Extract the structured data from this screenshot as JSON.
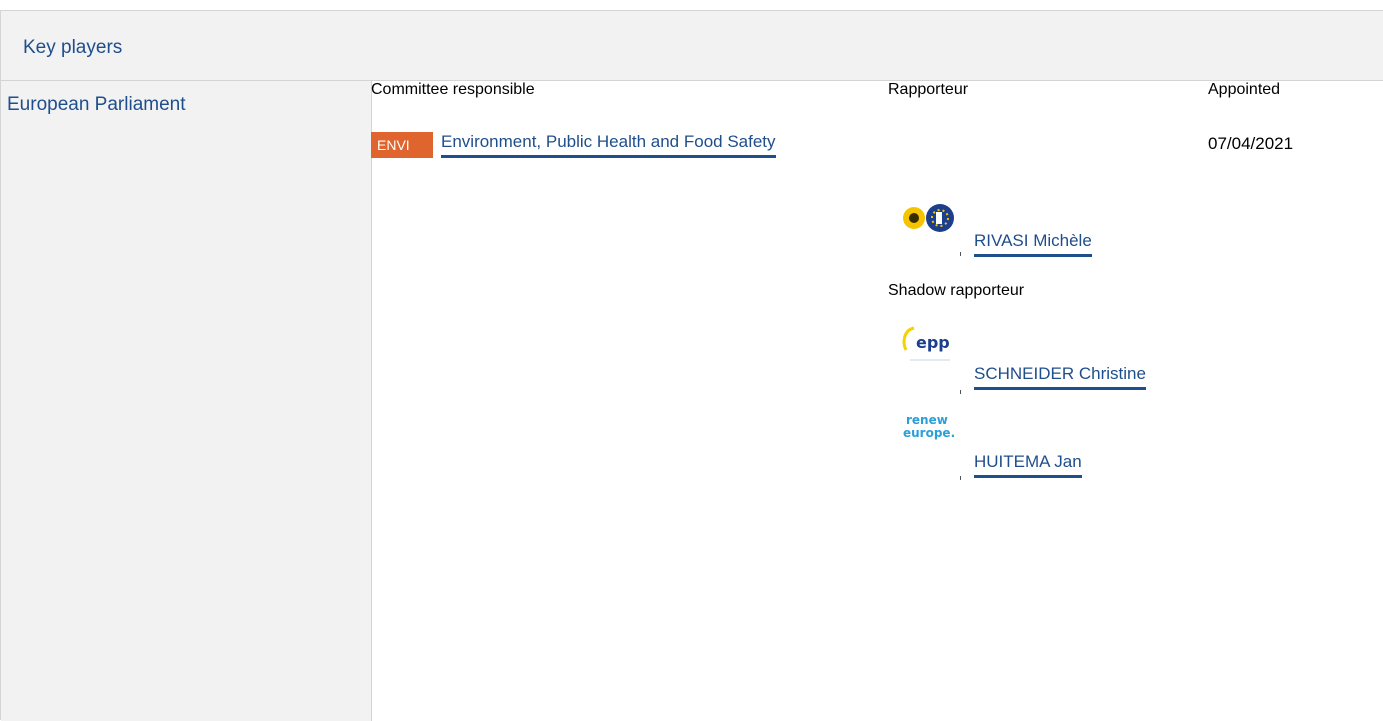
{
  "panel": {
    "title": "Key players"
  },
  "institution": {
    "name": "European Parliament"
  },
  "columns": {
    "committee": "Committee responsible",
    "rapporteur": "Rapporteur",
    "appointed": "Appointed"
  },
  "committee": {
    "badge": "ENVI",
    "name": "Environment, Public Health and Food Safety",
    "appointed": "07/04/2021",
    "badge_color": "#e0642e"
  },
  "rapporteur": {
    "name": "RIVASI Michèle",
    "group_logo": "greens-efa-logo"
  },
  "shadow": {
    "label": "Shadow rapporteur",
    "members": [
      {
        "name": "SCHNEIDER Christine",
        "group_logo": "epp-logo",
        "logo_text": "epp"
      },
      {
        "name": "HUITEMA Jan",
        "group_logo": "renew-europe-logo",
        "logo_text": "renew europe."
      }
    ]
  },
  "colors": {
    "link": "#1f4e8c",
    "header_bg": "#f2f2f2",
    "border": "#d4d4d4"
  }
}
